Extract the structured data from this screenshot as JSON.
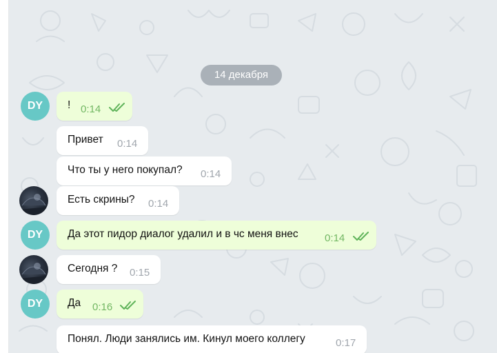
{
  "date_separator": "14 декабря",
  "avatars": {
    "self_initials": "DY"
  },
  "messages": [
    {
      "text": "!",
      "time": "0:14",
      "outgoing": true,
      "read": true
    },
    {
      "text": "Привет",
      "time": "0:14",
      "outgoing": false
    },
    {
      "text": "Что ты у него покупал?",
      "time": "0:14",
      "outgoing": false
    },
    {
      "text": "Есть скрины?",
      "time": "0:14",
      "outgoing": false
    },
    {
      "text": "Да этот пидор диалог удалил и в чс меня внес",
      "time": "0:14",
      "outgoing": true,
      "read": true
    },
    {
      "text": "Сегодня ?",
      "time": "0:15",
      "outgoing": false
    },
    {
      "text": "Да",
      "time": "0:16",
      "outgoing": true,
      "read": true
    },
    {
      "text": "Понял. Люди занялись им. Кинул моего коллегу",
      "time": "0:17",
      "outgoing": false
    }
  ],
  "icons": {
    "read_receipt": "double-check-icon",
    "contact_avatar": "contact-avatar-photo"
  },
  "colors": {
    "chat_background": "#e7ebee",
    "outgoing_bubble": "#eefed9",
    "incoming_bubble": "#ffffff",
    "avatar_initials_bg": "#67c8c6",
    "check_color": "#5fb35a"
  }
}
